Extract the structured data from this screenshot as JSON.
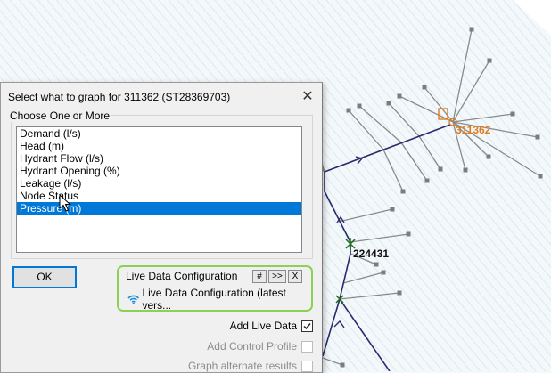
{
  "map": {
    "node_selected_label": "311362",
    "node_junction_label": "224431",
    "colors": {
      "pipe": "#2b2a6e",
      "branch": "#8a8a8a",
      "highlight": "#e07b1e",
      "junction": "#1a6b1a"
    }
  },
  "dialog": {
    "title": "Select what to graph for 311362 (ST28369703)",
    "close_icon": "close-icon",
    "group_label": "Choose One or More",
    "options": [
      "Demand (l/s)",
      "Head (m)",
      "Hydrant Flow (l/s)",
      "Hydrant Opening (%)",
      "Leakage (l/s)",
      "Node Status",
      "Pressure (m)"
    ],
    "selected_option": "Pressure (m)",
    "ok_label": "OK",
    "live_data": {
      "title": "Live Data Configuration",
      "buttons": [
        "#",
        ">>",
        "X"
      ],
      "item_icon": "wifi-icon",
      "item_label": "Live Data Configuration (latest vers..."
    },
    "add_live_data": {
      "label": "Add Live Data",
      "checked": true,
      "enabled": true
    },
    "add_control_profile": {
      "label": "Add Control Profile",
      "checked": false,
      "enabled": false
    },
    "graph_alternate": {
      "label": "Graph alternate results",
      "checked": false,
      "enabled": false
    }
  }
}
